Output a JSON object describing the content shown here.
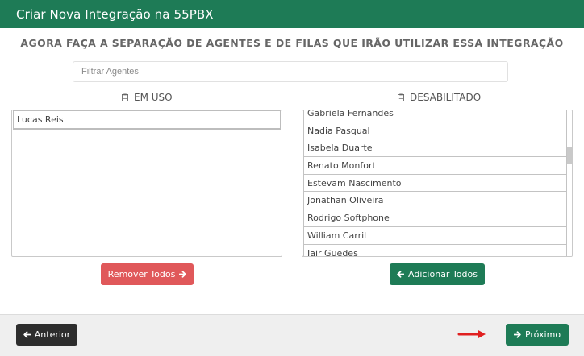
{
  "modal": {
    "title": "Criar Nova Integração na 55PBX",
    "subtitle": "AGORA FAÇA A SEPARAÇÃO DE AGENTES E DE FILAS QUE IRÃO UTILIZAR ESSA INTEGRAÇÃO"
  },
  "filter": {
    "placeholder": "Filtrar Agentes",
    "value": ""
  },
  "in_use": {
    "label": "EM USO",
    "icon": "clipboard-icon",
    "items": [
      "Lucas Reis"
    ]
  },
  "disabled": {
    "label": "DESABILITADO",
    "icon": "clipboard-icon",
    "items": [
      "Gabriela Fernandes",
      "Nadia Pasqual",
      "Isabela Duarte",
      "Renato Monfort",
      "Estevam Nascimento",
      "Jonathan Oliveira",
      "Rodrigo Softphone",
      "William Carril",
      "Jair Guedes"
    ]
  },
  "buttons": {
    "remove_all": "Remover Todos",
    "add_all": "Adicionar Todos",
    "previous": "Anterior",
    "next": "Próximo"
  },
  "colors": {
    "primary": "#1e7b56",
    "danger": "#e0585a",
    "dark": "#2d2d2d",
    "annotation": "#e02020"
  }
}
